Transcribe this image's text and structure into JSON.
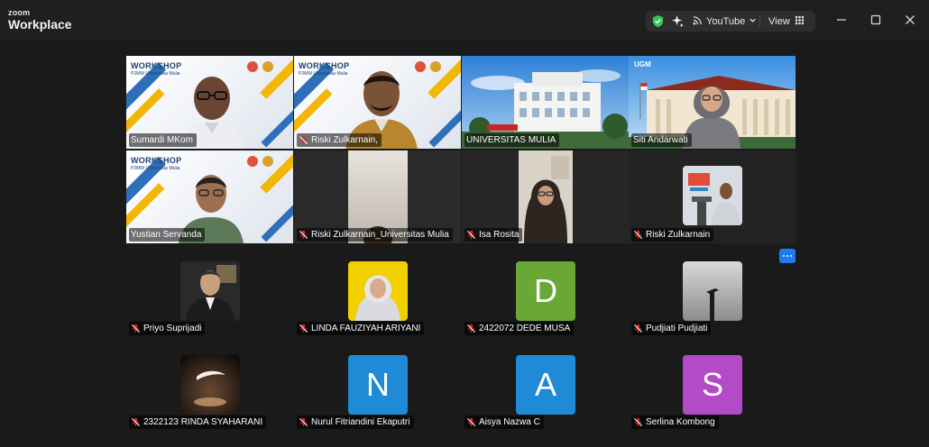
{
  "app": {
    "brand_top": "zoom",
    "brand_bottom": "Workplace"
  },
  "toolbar": {
    "stream_label": "YouTube",
    "view_label": "View"
  },
  "colors": {
    "accent_green": "#35c759",
    "accent_blue": "#1d7cf2",
    "mute_red": "#e02828",
    "avatar_green": "#6aa836",
    "avatar_blue": "#1f8ad6",
    "avatar_purple": "#b44ac7"
  },
  "workshop_banner": {
    "title": "WORKSHOP",
    "subtitle": "P2MW Universitas Mulia"
  },
  "video_tiles": [
    {
      "name": "Sumardi MKom",
      "muted": false,
      "active": true
    },
    {
      "name": "Riski Zulkarnain,",
      "muted": true,
      "active": false
    },
    {
      "name": "UNIVERSITAS MULIA",
      "muted": false,
      "active": false
    },
    {
      "name": "Siti Andarwati",
      "muted": false,
      "active": false
    },
    {
      "name": "Yustian Servanda",
      "muted": false,
      "active": false
    },
    {
      "name": "Riski Zulkarnain_Universitas Mulia",
      "muted": true,
      "active": false
    },
    {
      "name": "Isa Rosita",
      "muted": true,
      "active": false
    },
    {
      "name": "Riski Zulkarnain",
      "muted": true,
      "active": false
    }
  ],
  "campus_logo_text": "UGM",
  "avatar_tiles": [
    {
      "name": "Priyo Suprijadi",
      "initial": "",
      "kind": "photo-man"
    },
    {
      "name": "LINDA FAUZIYAH ARIYANI",
      "initial": "",
      "kind": "photo-woman"
    },
    {
      "name": "2422072 DEDE MUSA",
      "initial": "D",
      "kind": "letter-green"
    },
    {
      "name": "Pudjiati Pudjiati",
      "initial": "",
      "kind": "photo-dark"
    },
    {
      "name": "2322123 RINDA SYAHARANI",
      "initial": "",
      "kind": "photo-night"
    },
    {
      "name": "Nurul Fitriandini Ekaputri",
      "initial": "N",
      "kind": "letter-blue"
    },
    {
      "name": "Aisya Nazwa C",
      "initial": "A",
      "kind": "letter-blue"
    },
    {
      "name": "Serlina Kombong",
      "initial": "S",
      "kind": "letter-purple"
    }
  ]
}
